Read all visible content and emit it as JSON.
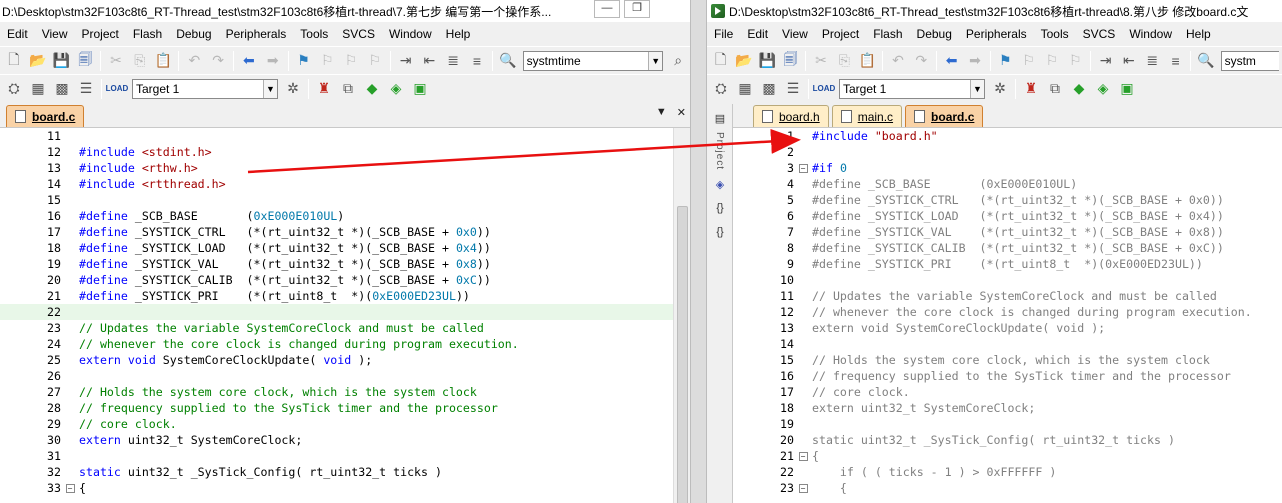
{
  "left": {
    "title": "D:\\Desktop\\stm32F103c8t6_RT-Thread_test\\stm32F103c8t6移植rt-thread\\7.第七步 编写第一个操作系...",
    "menus": [
      "Edit",
      "View",
      "Project",
      "Flash",
      "Debug",
      "Peripherals",
      "Tools",
      "SVCS",
      "Window",
      "Help"
    ],
    "search_combo": "systmtime",
    "target_combo": "Target 1",
    "tabs": [
      {
        "label": "board.c",
        "active": true
      }
    ],
    "lines": [
      {
        "n": "11",
        "html": ""
      },
      {
        "n": "12",
        "html": "<span class=\"pp\">#include</span> <span class=\"str\">&lt;stdint.h&gt;</span>"
      },
      {
        "n": "13",
        "html": "<span class=\"pp\">#include</span> <span class=\"str\">&lt;rthw.h&gt;</span>"
      },
      {
        "n": "14",
        "html": "<span class=\"pp\">#include</span> <span class=\"str\">&lt;rtthread.h&gt;</span>"
      },
      {
        "n": "15",
        "html": ""
      },
      {
        "n": "16",
        "html": "<span class=\"pp\">#define</span> _SCB_BASE       (<span class=\"num\">0xE000E010UL</span>)"
      },
      {
        "n": "17",
        "html": "<span class=\"pp\">#define</span> _SYSTICK_CTRL   (*(rt_uint32_t *)(_SCB_BASE + <span class=\"num\">0x0</span>))"
      },
      {
        "n": "18",
        "html": "<span class=\"pp\">#define</span> _SYSTICK_LOAD   (*(rt_uint32_t *)(_SCB_BASE + <span class=\"num\">0x4</span>))"
      },
      {
        "n": "19",
        "html": "<span class=\"pp\">#define</span> _SYSTICK_VAL    (*(rt_uint32_t *)(_SCB_BASE + <span class=\"num\">0x8</span>))"
      },
      {
        "n": "20",
        "html": "<span class=\"pp\">#define</span> _SYSTICK_CALIB  (*(rt_uint32_t *)(_SCB_BASE + <span class=\"num\">0xC</span>))"
      },
      {
        "n": "21",
        "html": "<span class=\"pp\">#define</span> _SYSTICK_PRI    (*(rt_uint8_t  *)(<span class=\"num\">0xE000ED23UL</span>))"
      },
      {
        "n": "22",
        "html": "",
        "cur": true
      },
      {
        "n": "23",
        "html": "<span class=\"cm\">// Updates the variable SystemCoreClock and must be called</span>"
      },
      {
        "n": "24",
        "html": "<span class=\"cm\">// whenever the core clock is changed during program execution.</span>"
      },
      {
        "n": "25",
        "html": "<span class=\"kw\">extern</span> <span class=\"kw\">void</span> SystemCoreClockUpdate( <span class=\"kw\">void</span> );"
      },
      {
        "n": "26",
        "html": ""
      },
      {
        "n": "27",
        "html": "<span class=\"cm\">// Holds the system core clock, which is the system clock</span>"
      },
      {
        "n": "28",
        "html": "<span class=\"cm\">// frequency supplied to the SysTick timer and the processor</span>"
      },
      {
        "n": "29",
        "html": "<span class=\"cm\">// core clock.</span>"
      },
      {
        "n": "30",
        "html": "<span class=\"kw\">extern</span> uint32_t SystemCoreClock;"
      },
      {
        "n": "31",
        "html": ""
      },
      {
        "n": "32",
        "html": "<span class=\"kw\">static</span> uint32_t _SysTick_Config( rt_uint32_t ticks )"
      },
      {
        "n": "33",
        "html": "{",
        "fold": "−"
      }
    ]
  },
  "right": {
    "title": "D:\\Desktop\\stm32F103c8t6_RT-Thread_test\\stm32F103c8t6移植rt-thread\\8.第八步 修改board.c文",
    "menus": [
      "File",
      "Edit",
      "View",
      "Project",
      "Flash",
      "Debug",
      "Peripherals",
      "Tools",
      "SVCS",
      "Window",
      "Help"
    ],
    "search_combo": "systm",
    "target_combo": "Target 1",
    "tabs": [
      {
        "label": "board.h",
        "active": false
      },
      {
        "label": "main.c",
        "active": false
      },
      {
        "label": "board.c",
        "active": true
      }
    ],
    "side_label": "Project",
    "lines": [
      {
        "n": "1",
        "html": "<span class=\"pp\">#include</span> <span class=\"str\">\"board.h\"</span>"
      },
      {
        "n": "2",
        "html": ""
      },
      {
        "n": "3",
        "html": "<span class=\"pp\">#if</span> <span class=\"num\">0</span>",
        "fold": "−"
      },
      {
        "n": "4",
        "html": "<span class=\"dis\">#define _SCB_BASE       (0xE000E010UL)</span>"
      },
      {
        "n": "5",
        "html": "<span class=\"dis\">#define _SYSTICK_CTRL   (*(rt_uint32_t *)(_SCB_BASE + 0x0))</span>"
      },
      {
        "n": "6",
        "html": "<span class=\"dis\">#define _SYSTICK_LOAD   (*(rt_uint32_t *)(_SCB_BASE + 0x4))</span>"
      },
      {
        "n": "7",
        "html": "<span class=\"dis\">#define _SYSTICK_VAL    (*(rt_uint32_t *)(_SCB_BASE + 0x8))</span>"
      },
      {
        "n": "8",
        "html": "<span class=\"dis\">#define _SYSTICK_CALIB  (*(rt_uint32_t *)(_SCB_BASE + 0xC))</span>"
      },
      {
        "n": "9",
        "html": "<span class=\"dis\">#define _SYSTICK_PRI    (*(rt_uint8_t  *)(0xE000ED23UL))</span>"
      },
      {
        "n": "10",
        "html": ""
      },
      {
        "n": "11",
        "html": "<span class=\"dis\">// Updates the variable SystemCoreClock and must be called</span>"
      },
      {
        "n": "12",
        "html": "<span class=\"dis\">// whenever the core clock is changed during program execution.</span>"
      },
      {
        "n": "13",
        "html": "<span class=\"dis\">extern void SystemCoreClockUpdate( void );</span>"
      },
      {
        "n": "14",
        "html": ""
      },
      {
        "n": "15",
        "html": "<span class=\"dis\">// Holds the system core clock, which is the system clock</span>"
      },
      {
        "n": "16",
        "html": "<span class=\"dis\">// frequency supplied to the SysTick timer and the processor</span>"
      },
      {
        "n": "17",
        "html": "<span class=\"dis\">// core clock.</span>"
      },
      {
        "n": "18",
        "html": "<span class=\"dis\">extern uint32_t SystemCoreClock;</span>"
      },
      {
        "n": "19",
        "html": ""
      },
      {
        "n": "20",
        "html": "<span class=\"dis\">static uint32_t _SysTick_Config( rt_uint32_t ticks )</span>"
      },
      {
        "n": "21",
        "html": "<span class=\"dis\">{</span>",
        "fold": "−"
      },
      {
        "n": "22",
        "html": "<span class=\"dis\">    if ( ( ticks - 1 ) &gt; 0xFFFFFF )</span>"
      },
      {
        "n": "23",
        "html": "<span class=\"dis\">    {</span>",
        "fold": "−"
      }
    ]
  },
  "colors": {
    "arrow": "#e81010",
    "active_tab": "#f9d2a6"
  }
}
